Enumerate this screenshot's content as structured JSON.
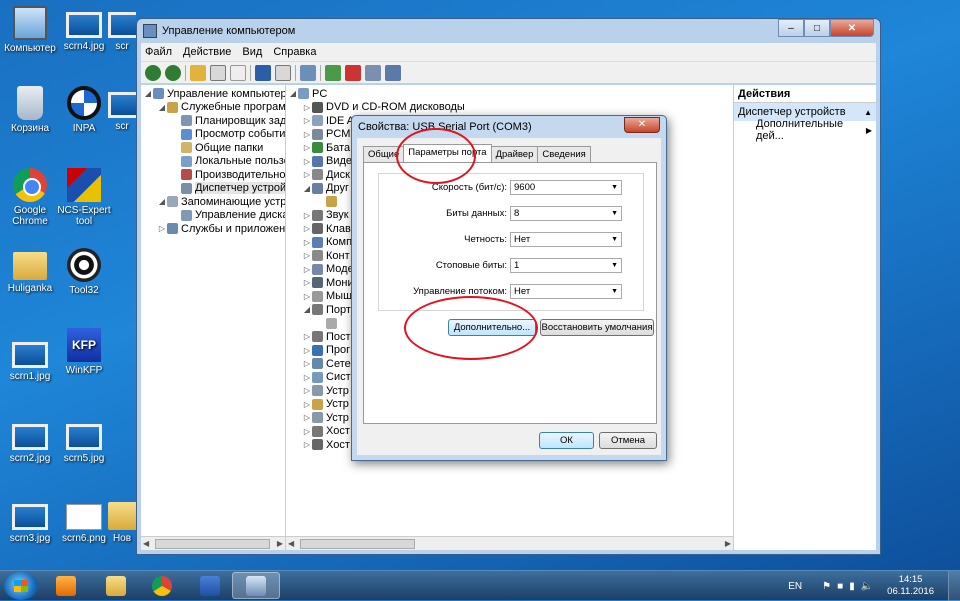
{
  "desktop": {
    "icons": [
      {
        "label": "Компьютер"
      },
      {
        "label": "scrn4.jpg"
      },
      {
        "label": "Корзина"
      },
      {
        "label": "INPA"
      },
      {
        "label": "Google Chrome"
      },
      {
        "label": "NCS-Expert tool"
      },
      {
        "label": "Huliganka"
      },
      {
        "label": "Tool32"
      },
      {
        "label": "WinKFP"
      },
      {
        "label": "scrn1.jpg"
      },
      {
        "label": "scrn2.jpg"
      },
      {
        "label": "scrn5.jpg"
      },
      {
        "label": "scrn3.jpg"
      },
      {
        "label": "scrn6.png"
      },
      {
        "label": "scr"
      },
      {
        "label": "scr"
      },
      {
        "label": "Нов"
      }
    ]
  },
  "window": {
    "title": "Управление компьютером",
    "menu": [
      "Файл",
      "Действие",
      "Вид",
      "Справка"
    ],
    "tree": [
      {
        "label": "Управление компьютером (л",
        "level": 0
      },
      {
        "label": "Служебные программы",
        "level": 1
      },
      {
        "label": "Планировщик заданий",
        "level": 2
      },
      {
        "label": "Просмотр событий",
        "level": 2
      },
      {
        "label": "Общие папки",
        "level": 2
      },
      {
        "label": "Локальные пользовате",
        "level": 2
      },
      {
        "label": "Производительность",
        "level": 2
      },
      {
        "label": "Диспетчер устройств",
        "level": 2
      },
      {
        "label": "Запоминающие устройств",
        "level": 1
      },
      {
        "label": "Управление дисками",
        "level": 2
      },
      {
        "label": "Службы и приложения",
        "level": 1
      }
    ],
    "devices": [
      {
        "label": "PC",
        "level": 0
      },
      {
        "label": "DVD и CD-ROM дисководы",
        "level": 1
      },
      {
        "label": "IDE ATA/ATAPI",
        "level": 1
      },
      {
        "label": "PCM",
        "level": 1
      },
      {
        "label": "Бата",
        "level": 1
      },
      {
        "label": "Виде",
        "level": 1
      },
      {
        "label": "Диск",
        "level": 1
      },
      {
        "label": "Друг",
        "level": 1
      },
      {
        "label": "",
        "level": 2
      },
      {
        "label": "Звук",
        "level": 1
      },
      {
        "label": "Клав",
        "level": 1
      },
      {
        "label": "Комп",
        "level": 1
      },
      {
        "label": "Конт",
        "level": 1
      },
      {
        "label": "Моде",
        "level": 1
      },
      {
        "label": "Мони",
        "level": 1
      },
      {
        "label": "Мыш",
        "level": 1
      },
      {
        "label": "Порт",
        "level": 1
      },
      {
        "label": "",
        "level": 2
      },
      {
        "label": "Пост",
        "level": 1
      },
      {
        "label": "Прог",
        "level": 1
      },
      {
        "label": "Сете",
        "level": 1
      },
      {
        "label": "Сист",
        "level": 1
      },
      {
        "label": "Устр",
        "level": 1
      },
      {
        "label": "Устр",
        "level": 1
      },
      {
        "label": "Устр",
        "level": 1
      },
      {
        "label": "Хост",
        "level": 1
      },
      {
        "label": "Хост",
        "level": 1
      }
    ],
    "actions": {
      "header": "Действия",
      "selected": "Диспетчер устройств",
      "item": "Дополнительные дей..."
    }
  },
  "dialog": {
    "title": "Свойства: USB Serial Port (COM3)",
    "tabs": [
      "Общие",
      "Параметры порта",
      "Драйвер",
      "Сведения"
    ],
    "active_tab": "Параметры порта",
    "fields": [
      {
        "label": "Скорость (бит/с):",
        "value": "9600"
      },
      {
        "label": "Биты данных:",
        "value": "8"
      },
      {
        "label": "Четность:",
        "value": "Нет"
      },
      {
        "label": "Стоповые биты:",
        "value": "1"
      },
      {
        "label": "Управление потоком:",
        "value": "Нет"
      }
    ],
    "advanced_button": "Дополнительно...",
    "restore_button": "Восстановить умолчания",
    "ok_button": "ОК",
    "cancel_button": "Отмена"
  },
  "taskbar": {
    "language": "EN",
    "time": "14:15",
    "date": "06.11.2016"
  },
  "colors": {
    "annotation": "#e0141e",
    "desktop": "#1f86d8"
  }
}
